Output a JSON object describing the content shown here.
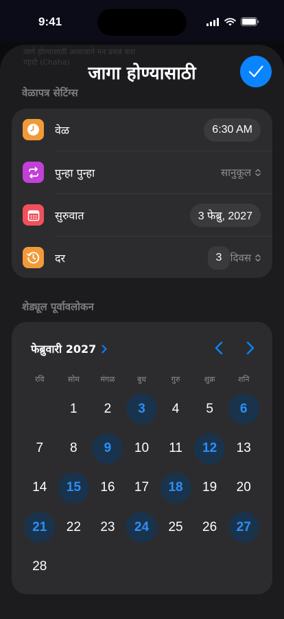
{
  "status": {
    "time": "9:41"
  },
  "sheet": {
    "ghost_text_1": "जागे होण्यासाठी आवाजाने मन प्रसन्न करा",
    "ghost_text_2": "पहाटे (Chaha)",
    "title": "जागा होण्यासाठी"
  },
  "schedule": {
    "section_label": "वेळापत्र सेटिंग्स",
    "rows": [
      {
        "label": "वेळ",
        "value": "6:30 AM",
        "icon": "clock-icon",
        "color": "#f29a38"
      },
      {
        "label": "पुन्हा पुन्हा",
        "value": "सानुकूल",
        "icon": "repeat-icon",
        "color": "#c240d8"
      },
      {
        "label": "सुरुवात",
        "value": "3 फेब्रु, 2027",
        "icon": "calendar-icon",
        "color": "#f0505a"
      },
      {
        "label": "दर",
        "number": "3",
        "value": "दिवस",
        "icon": "history-icon",
        "color": "#f29a38"
      }
    ]
  },
  "preview": {
    "section_label": "शेड्यूल पूर्वावलोकन",
    "month": "फेब्रुवारी 2027",
    "weekdays": [
      "रवि",
      "सोम",
      "मंगळ",
      "बुध",
      "गुरु",
      "शुक्र",
      "शनि"
    ],
    "start_offset": 1,
    "days": [
      "1",
      "2",
      "3",
      "4",
      "5",
      "6",
      "7",
      "8",
      "9",
      "10",
      "11",
      "12",
      "13",
      "14",
      "15",
      "16",
      "17",
      "18",
      "19",
      "20",
      "21",
      "22",
      "23",
      "24",
      "25",
      "26",
      "27",
      "28"
    ],
    "highlighted": [
      "3",
      "6",
      "9",
      "12",
      "15",
      "18",
      "21",
      "24",
      "27"
    ]
  },
  "colors": {
    "accent": "#0a84ff",
    "highlight_bg": "#19334d",
    "highlight_text": "#2b8ff5"
  }
}
